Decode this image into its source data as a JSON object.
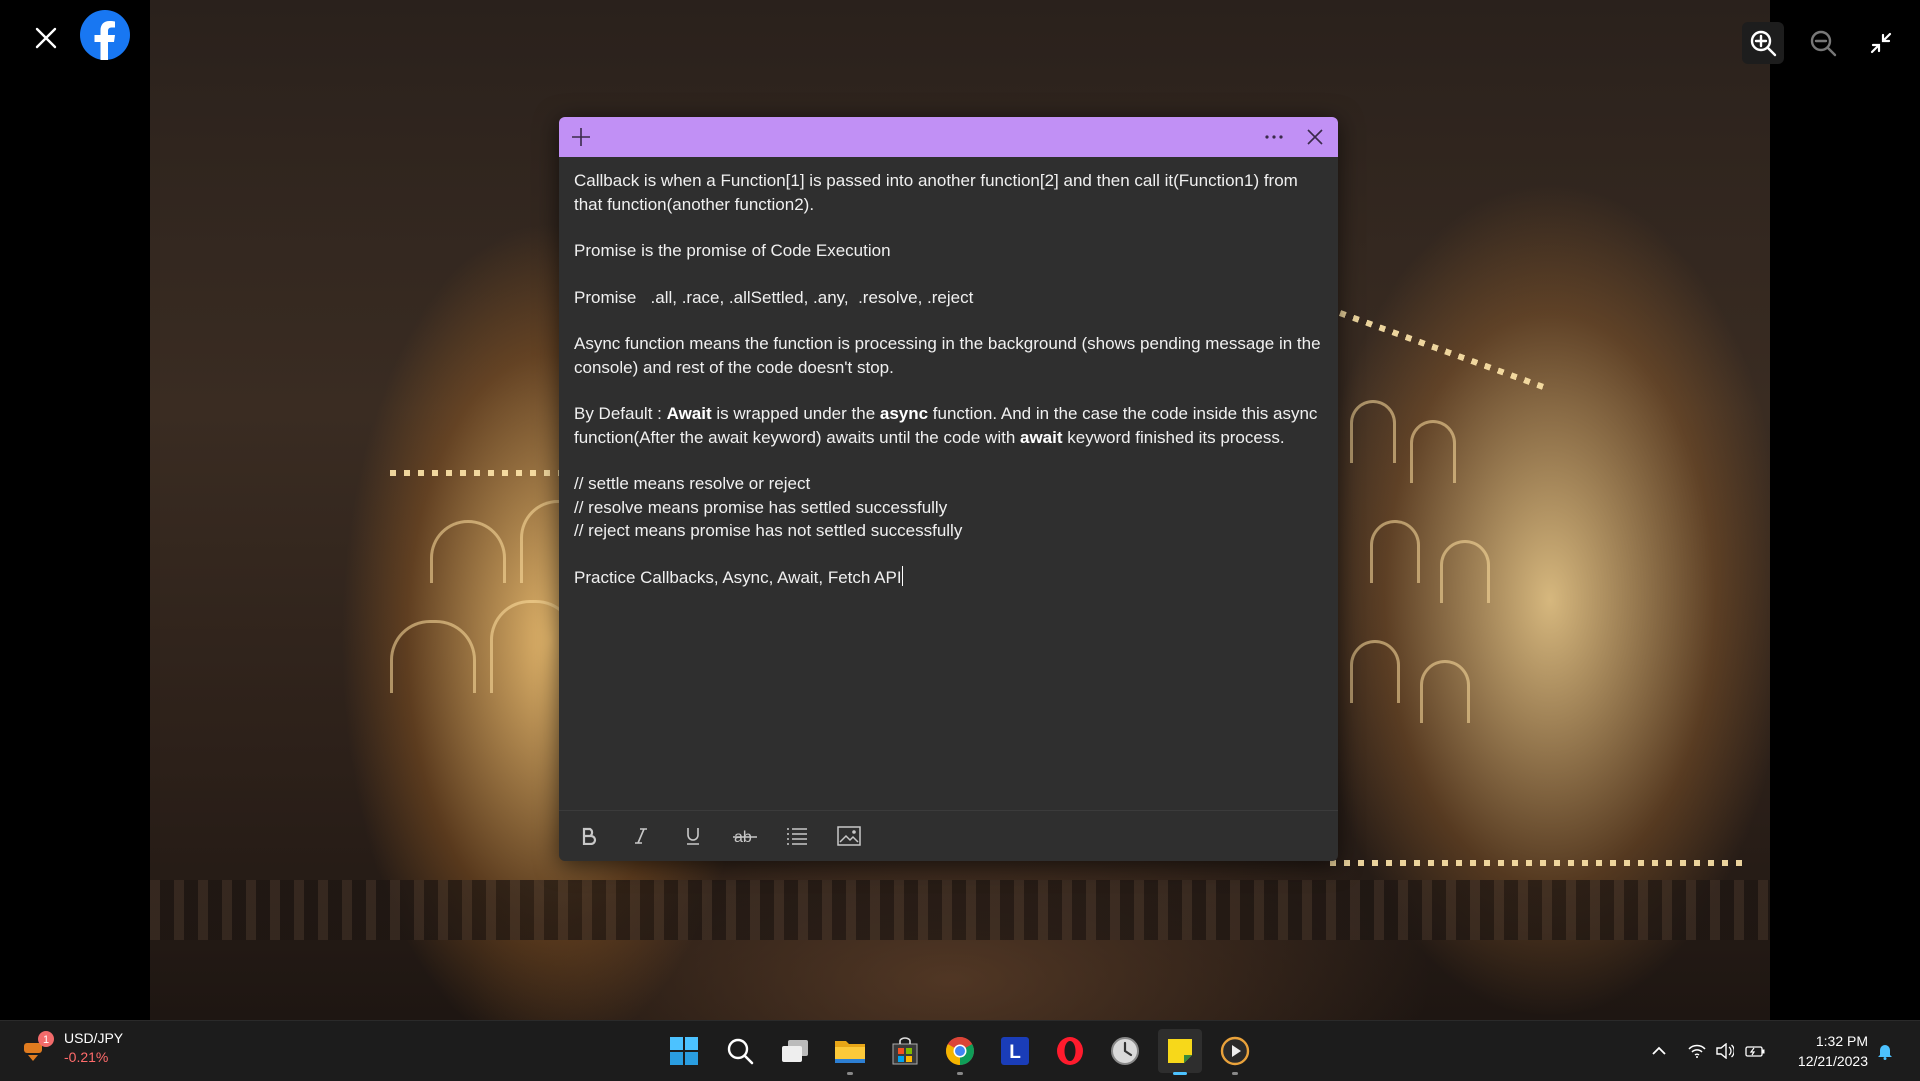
{
  "theme": {
    "accent": "#c190f5",
    "note_bg": "#2f2f2f",
    "taskbar_bg": "#1c1c1c"
  },
  "viewer": {
    "close_icon": "close-icon",
    "brand_icon": "facebook-logo",
    "zoom_in_icon": "zoom-in-icon",
    "zoom_out_icon": "zoom-out-icon",
    "collapse_icon": "collapse-icon"
  },
  "sticky_note": {
    "toolbar_icons": [
      "add-note-icon",
      "more-options-icon",
      "close-icon"
    ],
    "content": {
      "p1": "Callback is when a Function[1] is passed into another function[2] and then call it(Function1) from that function(another function2).",
      "p2": "Promise is the promise of Code Execution",
      "p3": "Promise   .all, .race, .allSettled, .any,  .resolve, .reject",
      "p4": "Async function means the function is processing in the background (shows pending message in the console) and rest of the code doesn't stop.",
      "p5_a": "By Default : ",
      "p5_b": "Await",
      "p5_c": " is wrapped under the ",
      "p5_d": "async",
      "p5_e": " function. And in the case the code inside this async function(After the await keyword) awaits until the code with ",
      "p5_f": "await",
      "p5_g": " keyword finished its process.",
      "c1": "// settle means resolve or reject",
      "c2": "// resolve means promise has settled successfully",
      "c3": "// reject means promise has not settled successfully",
      "p6": "Practice Callbacks, Async, Await, Fetch API"
    },
    "format_toolbar": [
      "bold-icon",
      "italic-icon",
      "underline-icon",
      "strikethrough-icon",
      "bullet-list-icon",
      "image-icon"
    ]
  },
  "taskbar": {
    "widget": {
      "pair": "USD/JPY",
      "change": "-0.21%",
      "badge": "1"
    },
    "apps": [
      "start-icon",
      "search-icon",
      "task-view-icon",
      "file-explorer-icon",
      "store-icon",
      "chrome-icon",
      "l-app-icon",
      "opera-icon",
      "clock-app-icon",
      "sticky-notes-icon",
      "media-player-icon"
    ],
    "l_app_letter": "L",
    "tray": [
      "chevron-up-icon",
      "wifi-icon",
      "volume-icon",
      "battery-icon",
      "notification-bell-icon"
    ],
    "time": "1:32 PM",
    "date": "12/21/2023"
  }
}
